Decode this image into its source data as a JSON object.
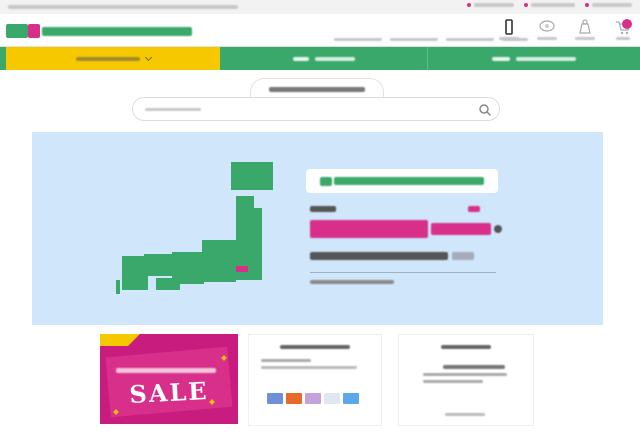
{
  "notice": {
    "text": "",
    "links": [
      "",
      "",
      ""
    ]
  },
  "header": {
    "logo_text": "",
    "links": [
      "",
      "",
      "",
      ""
    ],
    "icons": [
      {
        "icon": "user-icon",
        "label": ""
      },
      {
        "icon": "heart-icon",
        "label": ""
      },
      {
        "icon": "bag-icon",
        "label": ""
      },
      {
        "icon": "cart-icon",
        "label": ""
      }
    ]
  },
  "nav": {
    "items": [
      "",
      "",
      ""
    ]
  },
  "search": {
    "tab_label": "",
    "placeholder": ""
  },
  "hero": {
    "shop_name": "",
    "line1": "",
    "headline": "",
    "line3": "",
    "line4": ""
  },
  "promos": {
    "sale_sub": "",
    "sale_word": "SALE",
    "card2_title": "",
    "card2_rows": [
      "",
      ""
    ],
    "card3_title": "",
    "card3_rows": [
      "",
      "",
      ""
    ]
  },
  "colors": {
    "brand_green": "#3aa86b",
    "accent_yellow": "#f5c800",
    "accent_pink": "#d8308a",
    "hero_bg": "#cfe6fb"
  }
}
